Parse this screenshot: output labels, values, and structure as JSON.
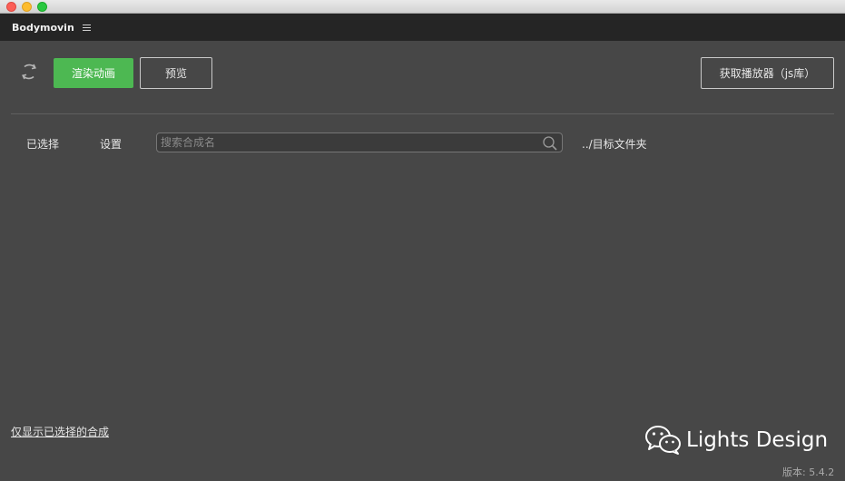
{
  "panel": {
    "title": "Bodymovin"
  },
  "toolbar": {
    "render_label": "渲染动画",
    "preview_label": "预览",
    "get_player_label": "获取播放器（js库）"
  },
  "tabs": {
    "selected_label": "已选择",
    "settings_label": "设置"
  },
  "search": {
    "placeholder": "搜索合成名"
  },
  "destination": {
    "label": "../目标文件夹"
  },
  "footer": {
    "show_selected_label": "仅显示已选择的合成",
    "watermark": "Lights Design",
    "version": "版本: 5.4.2"
  },
  "colors": {
    "background": "#474747",
    "panel_bar": "#252525",
    "accent_green": "#4db852",
    "border": "#c9c9c9"
  },
  "icons": {
    "refresh": "refresh-icon",
    "menu": "hamburger-menu-icon",
    "search": "search-icon",
    "wechat": "wechat-icon"
  }
}
